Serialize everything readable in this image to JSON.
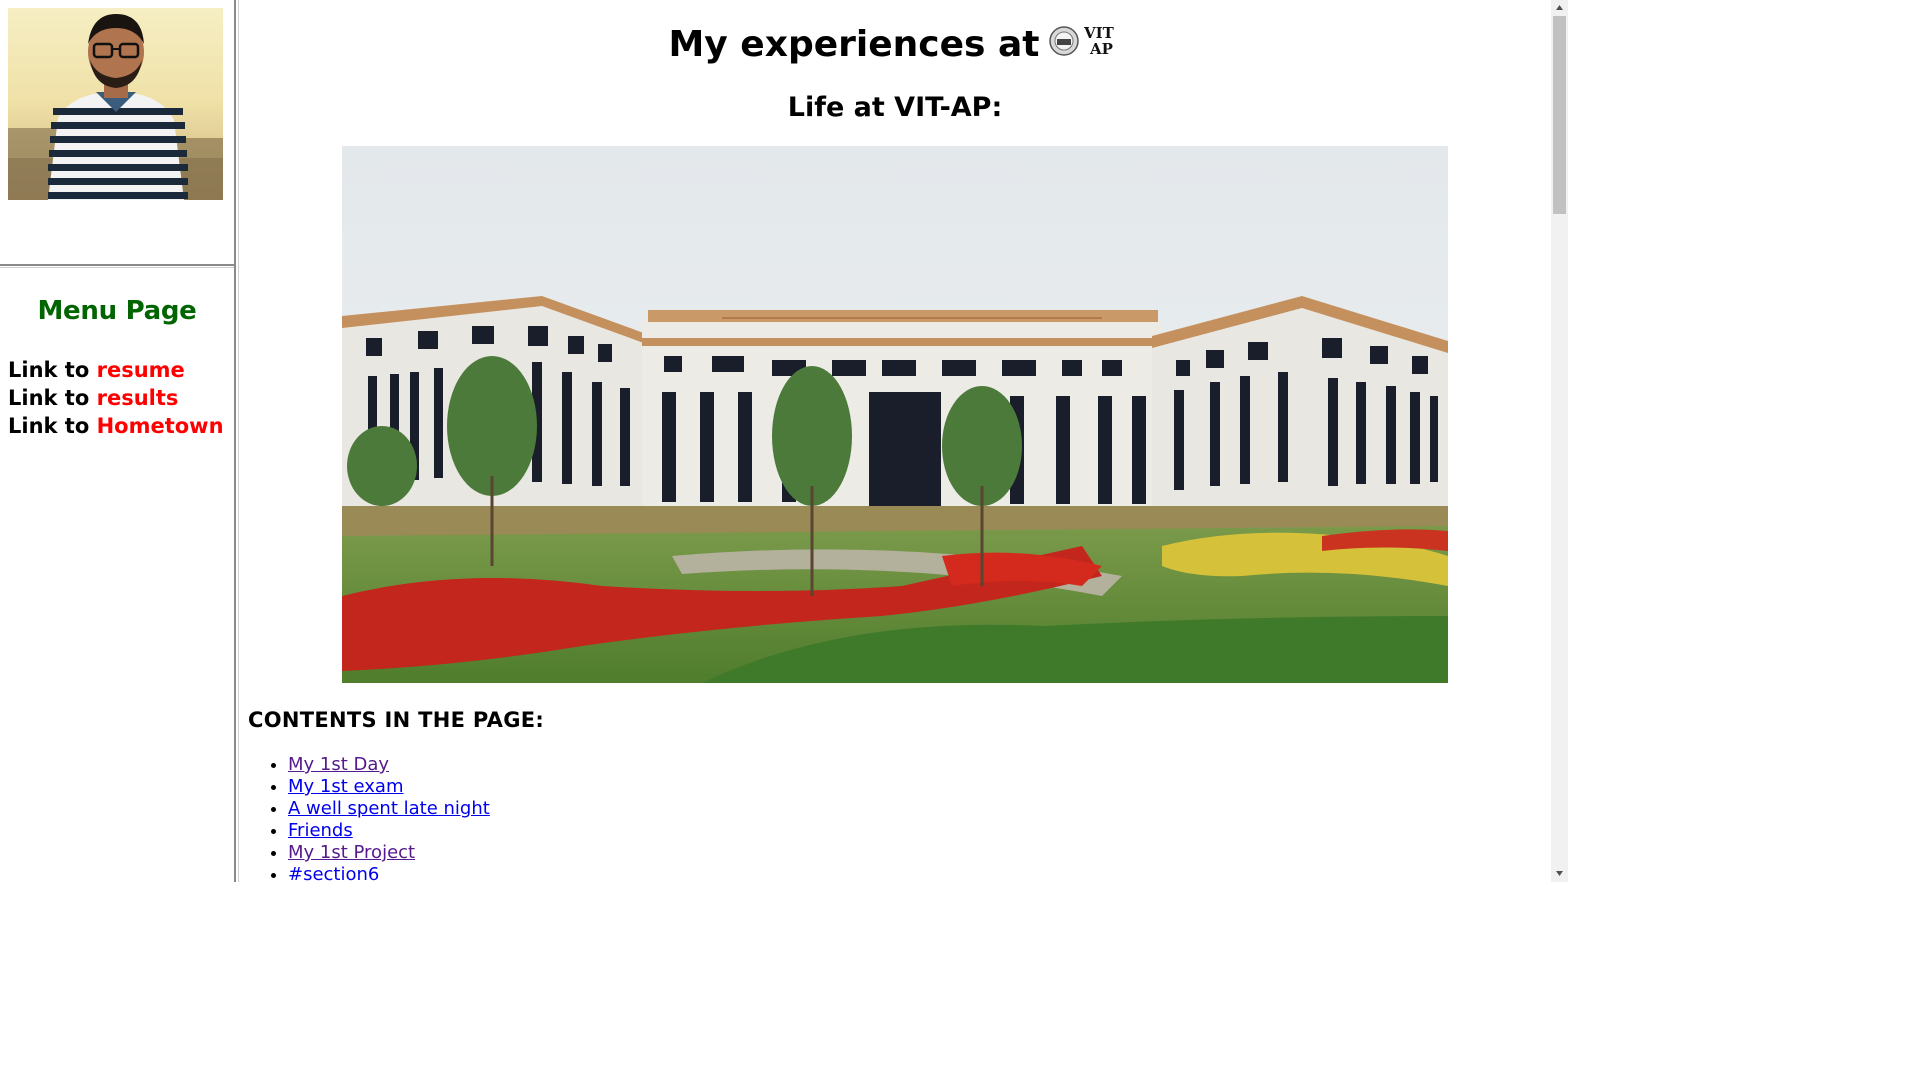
{
  "photo": {
    "alt": "profile-photo"
  },
  "menu": {
    "title": "Menu Page",
    "links": [
      {
        "prefix": "Link to ",
        "label": "resume"
      },
      {
        "prefix": "Link to ",
        "label": "results"
      },
      {
        "prefix": "Link to ",
        "label": "Hometown"
      }
    ]
  },
  "main": {
    "title": "My experiences at",
    "logo_text_top": "VIT",
    "logo_text_bottom": "AP",
    "subtitle": "Life at VIT-AP:",
    "contents_heading": "CONTENTS IN THE PAGE:",
    "contents": [
      {
        "label": "My 1st Day",
        "state": "visited"
      },
      {
        "label": "My 1st exam",
        "state": "unvisited"
      },
      {
        "label": "A well spent late night",
        "state": "unvisited"
      },
      {
        "label": "Friends",
        "state": "unvisited"
      },
      {
        "label": "My 1st Project",
        "state": "visited"
      },
      {
        "label": "#section6",
        "state": "plain"
      }
    ]
  },
  "colors": {
    "menu_title": "#006400",
    "menu_link": "#ff0000",
    "link_visited": "#551a8b",
    "link_unvisited": "#0000ee"
  }
}
